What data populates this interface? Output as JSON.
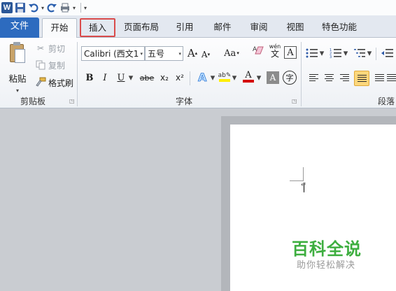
{
  "qat": {
    "app_logo": "W",
    "icons": [
      "word-logo-icon",
      "save-icon",
      "undo-icon",
      "redo-icon",
      "format-painter-icon",
      "customize-icon"
    ]
  },
  "tabs": [
    {
      "key": "file",
      "label": "文件",
      "state": "file"
    },
    {
      "key": "home",
      "label": "开始",
      "state": "selected"
    },
    {
      "key": "insert",
      "label": "插入",
      "state": "highlighted"
    },
    {
      "key": "layout",
      "label": "页面布局"
    },
    {
      "key": "references",
      "label": "引用"
    },
    {
      "key": "mailings",
      "label": "邮件"
    },
    {
      "key": "review",
      "label": "审阅"
    },
    {
      "key": "view",
      "label": "视图"
    },
    {
      "key": "special",
      "label": "特色功能"
    }
  ],
  "clipboard": {
    "paste_label": "粘贴",
    "cut_label": "剪切",
    "copy_label": "复制",
    "format_painter_label": "格式刷",
    "group_label": "剪贴板"
  },
  "font": {
    "font_name": "Calibri (西文1",
    "font_size": "五号",
    "grow_label": "A",
    "shrink_label": "A",
    "change_case_label": "Aa",
    "phonetic_label": "wén",
    "bold_label": "B",
    "italic_label": "I",
    "underline_label": "U",
    "strike_label": "abe",
    "subscript_label": "x₂",
    "superscript_label": "x²",
    "font_color_label": "A",
    "char_shading_label": "A",
    "enclose_label": "字",
    "group_label": "字体"
  },
  "paragraph": {
    "group_label": "段落"
  },
  "document": {
    "paragraph_mark": "↵"
  },
  "watermark": {
    "title": "百科全说",
    "subtitle": "助你轻松解决"
  },
  "colors": {
    "file_tab": "#2d6bbf",
    "insert_highlight": "#d94b4b",
    "highlight_yellow": "#ffee00",
    "font_red": "#d40000",
    "watermark_green": "#3dae3f",
    "active_align": "#fcd77c"
  }
}
